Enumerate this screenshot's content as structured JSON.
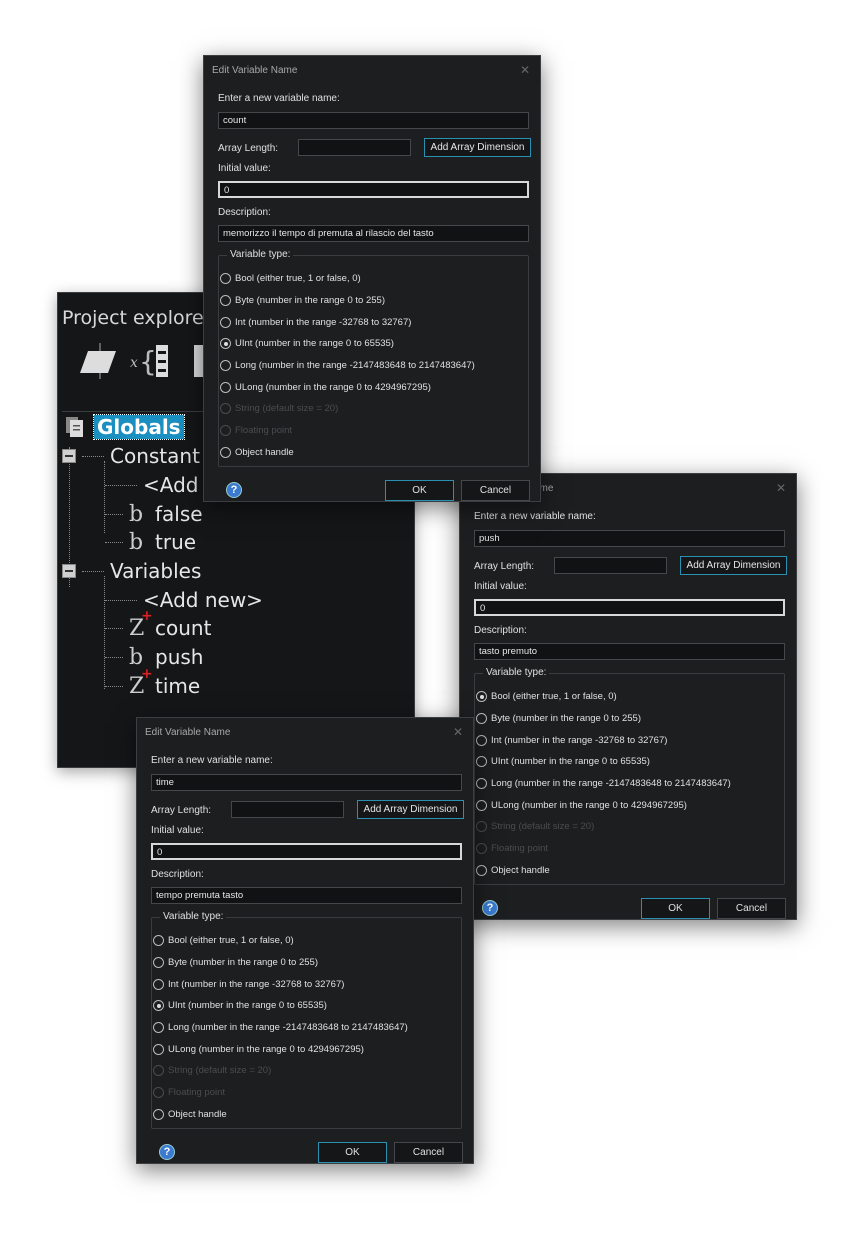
{
  "project_explorer": {
    "title": "Project explorer",
    "tree": {
      "root": "Globals",
      "constants": {
        "label": "Constant",
        "items": [
          "<Add",
          "false",
          "true"
        ]
      },
      "variables": {
        "label": "Variables",
        "items": [
          "<Add new>",
          "count",
          "push",
          "time"
        ]
      }
    }
  },
  "dialogs": [
    {
      "title": "Edit Variable Name",
      "name_label": "Enter a new variable name:",
      "name_value": "count",
      "array_length_label": "Array Length:",
      "array_length_value": "",
      "add_array_dimension": "Add Array Dimension",
      "initial_value_label": "Initial value:",
      "initial_value": "0",
      "description_label": "Description:",
      "description": "memorizzo il tempo di premuta al rilascio del tasto",
      "variable_type_label": "Variable type:",
      "selected_type": "UInt",
      "ok": "OK",
      "cancel": "Cancel"
    },
    {
      "title": "Edit Variable Name",
      "name_label": "Enter a new variable name:",
      "name_value": "push",
      "array_length_label": "Array Length:",
      "array_length_value": "",
      "add_array_dimension": "Add Array Dimension",
      "initial_value_label": "Initial value:",
      "initial_value": "0",
      "description_label": "Description:",
      "description": "tasto premuto",
      "variable_type_label": "Variable type:",
      "selected_type": "Bool",
      "ok": "OK",
      "cancel": "Cancel"
    },
    {
      "title": "Edit Variable Name",
      "name_label": "Enter a new variable name:",
      "name_value": "time",
      "array_length_label": "Array Length:",
      "array_length_value": "",
      "add_array_dimension": "Add Array Dimension",
      "initial_value_label": "Initial value:",
      "initial_value": "0",
      "description_label": "Description:",
      "description": "tempo premuta tasto",
      "variable_type_label": "Variable type:",
      "selected_type": "UInt",
      "ok": "OK",
      "cancel": "Cancel"
    }
  ],
  "variable_types": [
    {
      "key": "Bool",
      "label": "Bool (either true, 1 or false, 0)",
      "enabled": true
    },
    {
      "key": "Byte",
      "label": "Byte (number in the range 0 to 255)",
      "enabled": true
    },
    {
      "key": "Int",
      "label": "Int (number in the range -32768 to 32767)",
      "enabled": true
    },
    {
      "key": "UInt",
      "label": "UInt (number in the range 0 to 65535)",
      "enabled": true
    },
    {
      "key": "Long",
      "label": "Long (number in the range -2147483648 to 2147483647)",
      "enabled": true
    },
    {
      "key": "ULong",
      "label": "ULong (number in the range 0 to 4294967295)",
      "enabled": true
    },
    {
      "key": "String",
      "label": "String (default size = 20)",
      "enabled": false
    },
    {
      "key": "Float",
      "label": "Floating point",
      "enabled": false
    },
    {
      "key": "Object",
      "label": "Object handle",
      "enabled": true
    }
  ]
}
